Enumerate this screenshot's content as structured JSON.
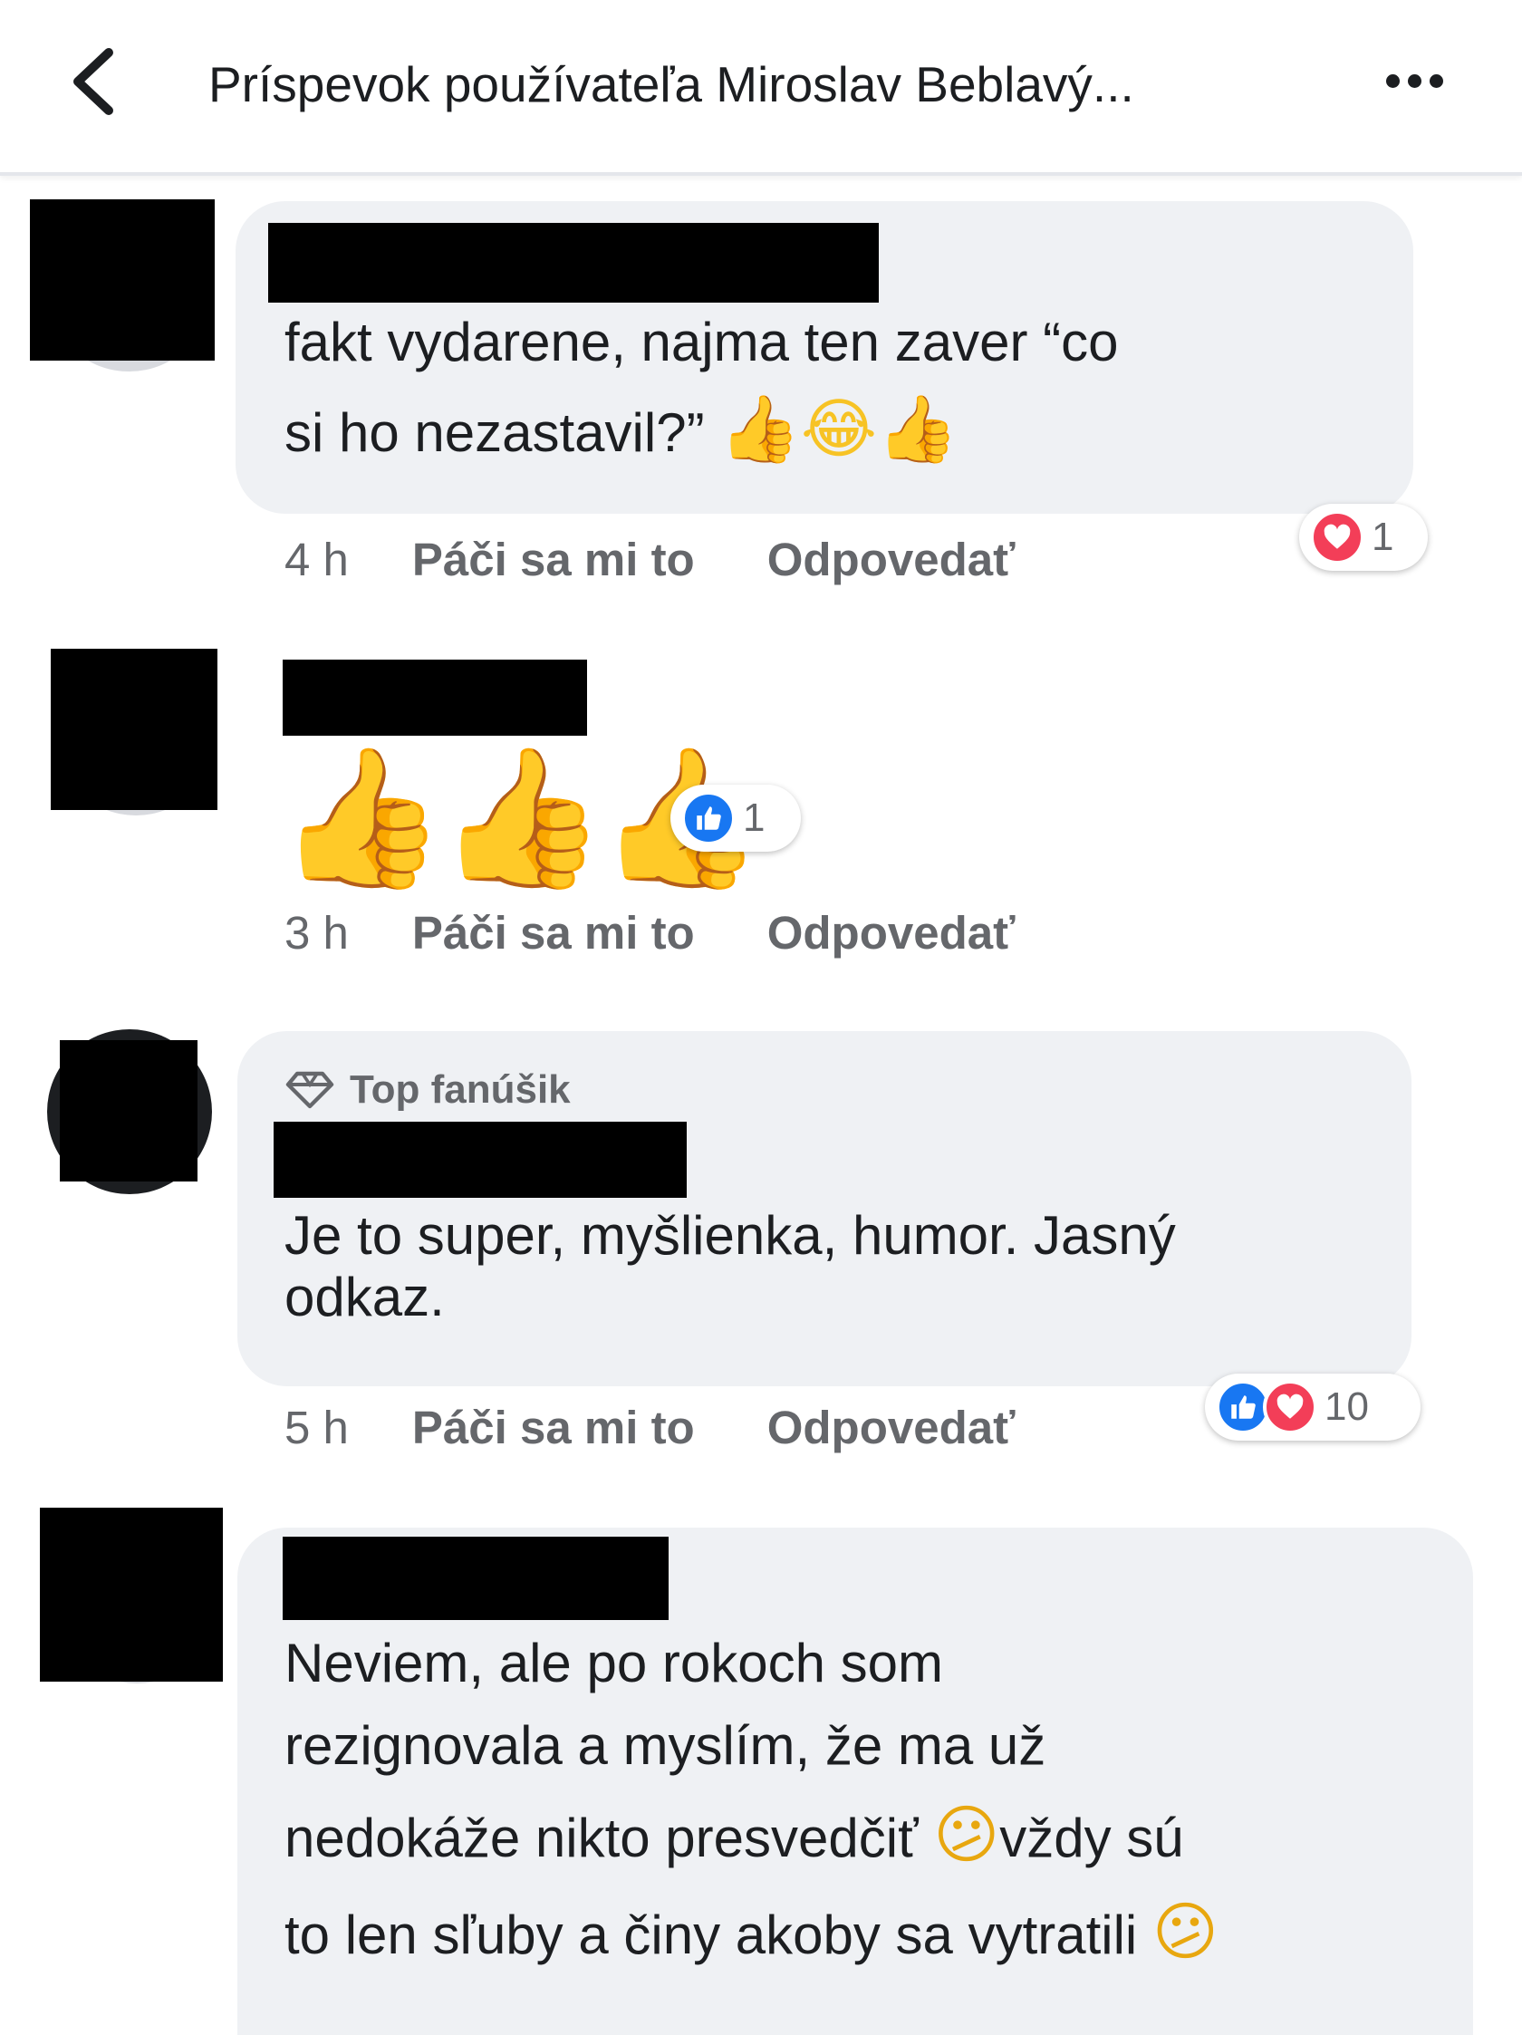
{
  "header": {
    "title": "Príspevok používateľa Miroslav Beblavý...",
    "back_icon": "chevron-left-icon",
    "more_icon": "more-dots-icon"
  },
  "comments": [
    {
      "text_lines": [
        "fakt vydarene,  najma  ten  zaver  “co",
        "si  ho  nezastavil?”"
      ],
      "emoji": "👍😂👍",
      "time": "4 h",
      "like_label": "Páči sa mi to",
      "reply_label": "Odpovedať",
      "reactions": [
        "love"
      ],
      "reaction_count": "1"
    },
    {
      "emoji": "👍👍👍",
      "time": "3 h",
      "like_label": "Páči sa mi to",
      "reply_label": "Odpovedať",
      "reactions": [
        "like"
      ],
      "reaction_count": "1"
    },
    {
      "badge": "Top fanúšik",
      "text_lines": [
        "Je to super, myšlienka, humor. Jasný",
        "odkaz."
      ],
      "time": "5 h",
      "like_label": "Páči sa mi to",
      "reply_label": "Odpovedať",
      "reactions": [
        "like",
        "love"
      ],
      "reaction_count": "10"
    },
    {
      "text_lines": [
        "Neviem, ale po rokoch som",
        "rezignovala a myslím, že ma už",
        "nedokáže nikto presvedčiť",
        "to len sľuby a činy akoby sa vytratili"
      ],
      "line3_tail": "vždy sú",
      "emoji_confused": "😕"
    }
  ],
  "colors": {
    "bubble": "#eff1f4",
    "meta": "#65676b",
    "like_blue": "#1877f2",
    "love_red": "#f33e58"
  }
}
